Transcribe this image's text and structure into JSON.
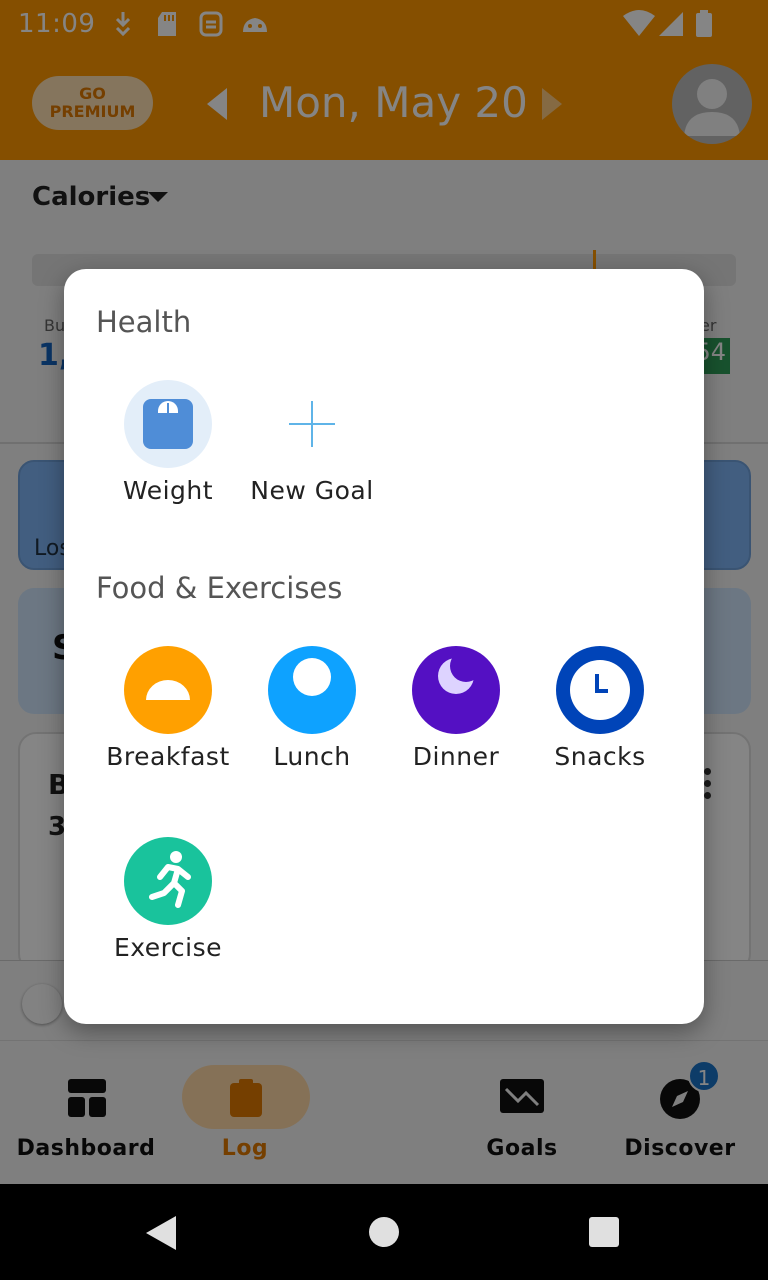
{
  "status_bar": {
    "time": "11:09",
    "color": "#ff9800"
  },
  "header": {
    "premium_label": "GO\nPREMIUM",
    "date": "Mon, May 20",
    "accent": "#ff9800"
  },
  "background": {
    "calories_label": "Calories",
    "budget_label_partial": "Bu",
    "budget_value_partial": "1,",
    "under_label_partial": "er",
    "under_value_partial": "54",
    "card_label_partial": "Los",
    "card2_text_partial": "S",
    "card3_title_partial": "B",
    "card3_value_partial": "3"
  },
  "dialog": {
    "health_title": "Health",
    "health_items": [
      {
        "label": "Weight",
        "icon": "scale-icon"
      },
      {
        "label": "New Goal",
        "icon": "plus-icon"
      }
    ],
    "food_title": "Food & Exercises",
    "food_items": [
      {
        "label": "Breakfast",
        "icon": "sunrise-icon",
        "color": "#ffa000"
      },
      {
        "label": "Lunch",
        "icon": "sun-icon",
        "color": "#0ea2ff"
      },
      {
        "label": "Dinner",
        "icon": "moon-icon",
        "color": "#5410c3"
      },
      {
        "label": "Snacks",
        "icon": "clock-icon",
        "color": "#0044b8"
      },
      {
        "label": "Exercise",
        "icon": "running-icon",
        "color": "#19c39c"
      }
    ]
  },
  "bottom_nav": {
    "items": [
      {
        "label": "Dashboard",
        "icon": "dashboard-icon"
      },
      {
        "label": "Log",
        "icon": "clipboard-icon"
      },
      {
        "label": "Goals",
        "icon": "trend-down-icon"
      },
      {
        "label": "Discover",
        "icon": "compass-icon"
      }
    ],
    "discover_badge": "1"
  }
}
